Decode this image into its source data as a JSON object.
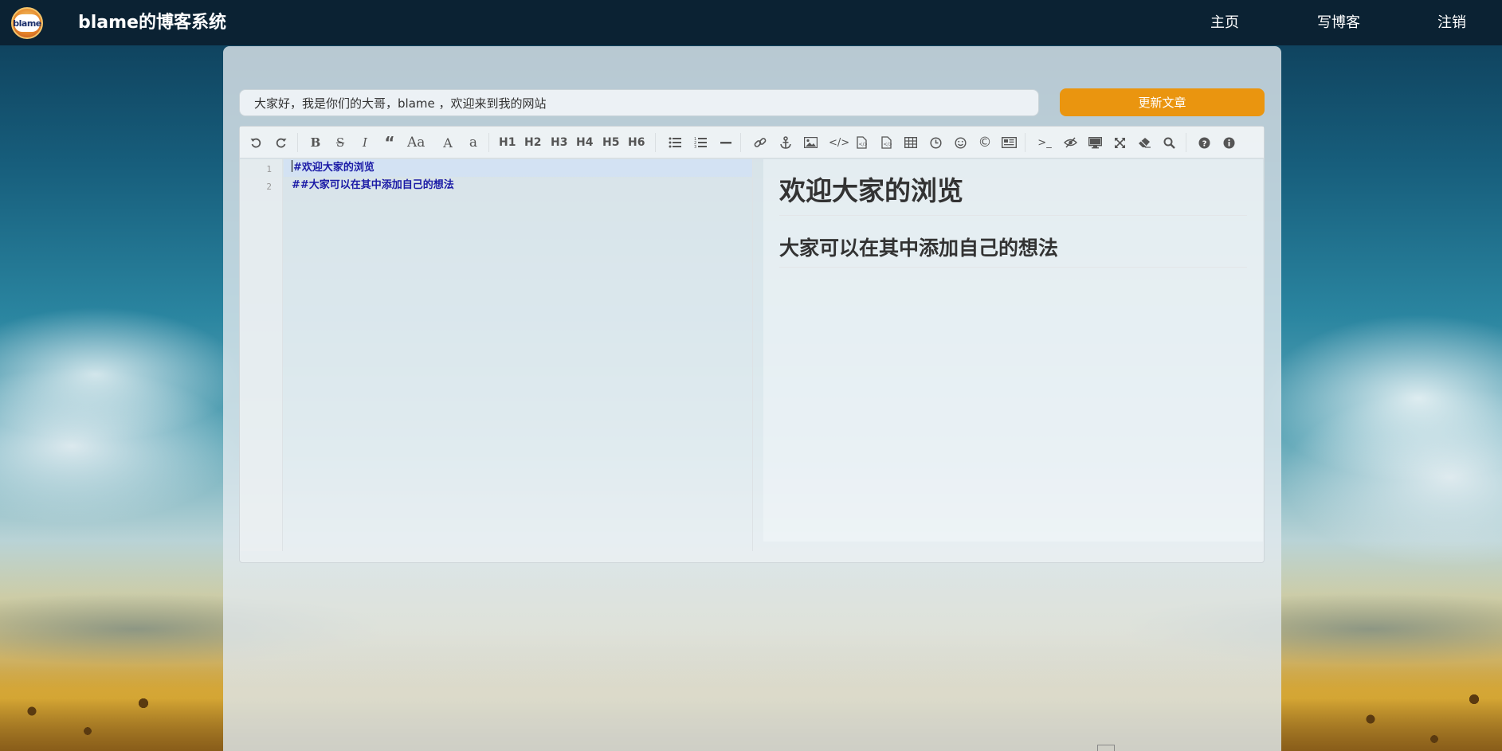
{
  "navbar": {
    "logo_text": "blame",
    "site_title": "blame的博客系统",
    "links": [
      {
        "label": "主页",
        "name": "nav-home-link"
      },
      {
        "label": "写博客",
        "name": "nav-write-link"
      },
      {
        "label": "注销",
        "name": "nav-logout-link"
      }
    ]
  },
  "form": {
    "title_value": "大家好，我是你们的大哥，blame ，欢迎来到我的网站",
    "title_placeholder": "",
    "submit_label": "更新文章"
  },
  "toolbar": {
    "undo_icon": "undo-icon",
    "redo_icon": "redo-icon",
    "bold_label": "B",
    "strike_label": "S",
    "italic_label": "I",
    "quote_icon": "quote-icon",
    "uppercase_label": "Aa",
    "uppercase_first_label": "A",
    "lowercase_label": "a",
    "headings": [
      "H1",
      "H2",
      "H3",
      "H4",
      "H5",
      "H6"
    ],
    "icons": [
      "unordered-list-icon",
      "ordered-list-icon",
      "horizontal-rule-icon",
      "link-icon",
      "anchor-icon",
      "image-icon",
      "code-icon",
      "code-block-icon",
      "preformatted-icon",
      "table-icon",
      "datetime-icon",
      "emoji-icon",
      "html-entities-icon",
      "pagebreak-icon",
      "goto-line-icon",
      "watch-icon",
      "preview-icon",
      "fullscreen-icon",
      "clear-icon",
      "search-icon",
      "help-icon",
      "info-icon"
    ]
  },
  "editor": {
    "lines": [
      {
        "num": "1",
        "text": "#欢迎大家的浏览"
      },
      {
        "num": "2",
        "text": "##大家可以在其中添加自己的想法"
      }
    ]
  },
  "preview": {
    "h1": "欢迎大家的浏览",
    "h2": "大家可以在其中添加自己的想法"
  },
  "colors": {
    "navbar_bg": "#0b2233",
    "accent": "#ea950f",
    "markdown_text": "#1a1aa6"
  }
}
